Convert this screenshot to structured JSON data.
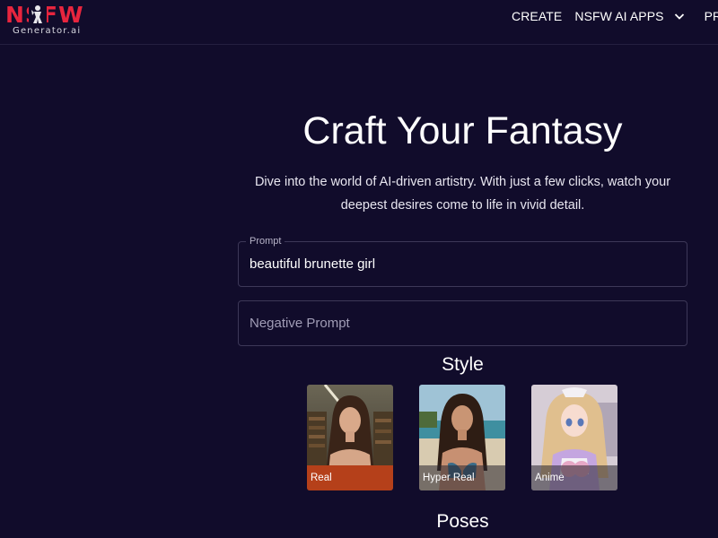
{
  "brand": {
    "logo_text": "NSFW",
    "logo_subtext": "Generator.ai",
    "accent": "#e8253e"
  },
  "nav": {
    "items": [
      {
        "label": "CREATE"
      },
      {
        "label": "NSFW AI APPS",
        "icon": "chevron-down-icon"
      },
      {
        "label": "PRICING"
      }
    ]
  },
  "hero": {
    "title": "Craft Your Fantasy",
    "subtitle": "Dive into the world of AI-driven artistry. With just a few clicks, watch your deepest desires come to life in vivid detail."
  },
  "form": {
    "prompt_label": "Prompt",
    "prompt_value": "beautiful brunette girl",
    "negative_placeholder": "Negative Prompt"
  },
  "style": {
    "title": "Style",
    "selected": "Real",
    "selected_color": "#b5401a",
    "cards": [
      {
        "label": "Real"
      },
      {
        "label": "Hyper Real"
      },
      {
        "label": "Anime"
      }
    ]
  },
  "poses": {
    "title": "Poses"
  },
  "colors": {
    "background": "#110c2b",
    "border": "#3d3858"
  }
}
